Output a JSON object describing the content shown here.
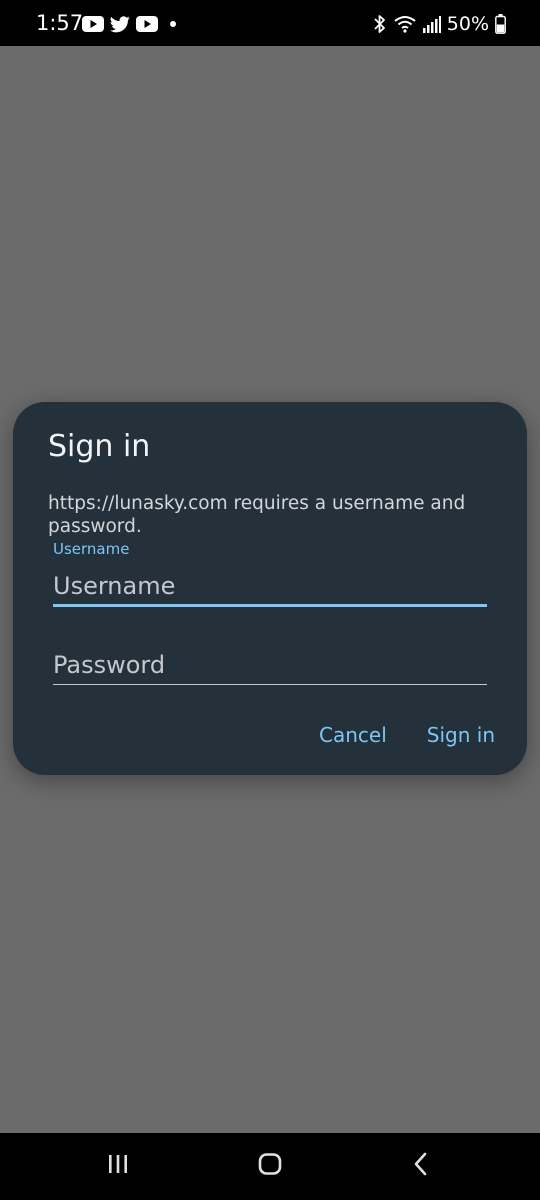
{
  "status_bar": {
    "time": "1:57",
    "battery": "50%",
    "left_icons": [
      "youtube-icon",
      "twitter-icon",
      "youtube-icon",
      "notification-dot-icon"
    ],
    "right_icons": [
      "bluetooth-icon",
      "wifi-icon",
      "signal-icon",
      "battery-icon"
    ]
  },
  "dialog": {
    "title": "Sign in",
    "message": "https://lunasky.com requires a username and password.",
    "username_label": "Username",
    "username_placeholder": "Username",
    "username_value": "",
    "password_placeholder": "Password",
    "password_value": "",
    "cancel_label": "Cancel",
    "signin_label": "Sign in"
  },
  "nav_bar": {
    "buttons": [
      "recents-icon",
      "home-icon",
      "back-icon"
    ]
  },
  "colors": {
    "scrim": "#6b6b6b",
    "dialog_bg": "#24303a",
    "accent": "#7cc6f5",
    "text_primary": "#f1f3f4",
    "text_secondary": "#d4d7da"
  }
}
